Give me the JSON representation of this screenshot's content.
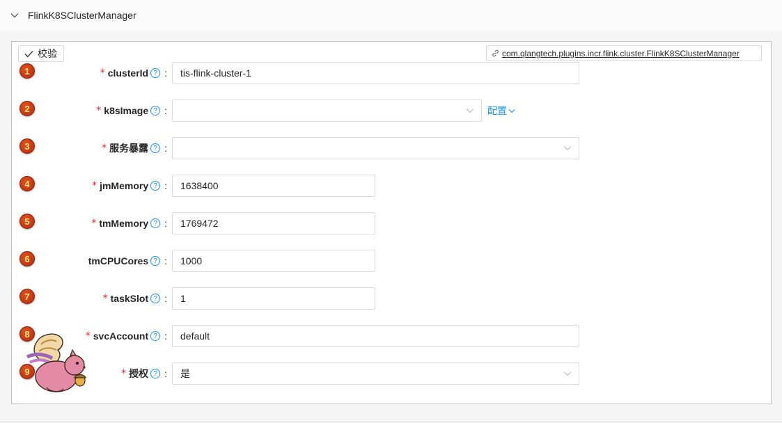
{
  "panel": {
    "title": "FlinkK8SClusterManager",
    "verify_label": "校验",
    "impl_link": "com.qlangtech.plugins.incr.flink.cluster.FlinkK8SClusterManager"
  },
  "fields": [
    {
      "badge": "1",
      "label": "clusterId",
      "required": true,
      "value": "tis-flink-cluster-1"
    },
    {
      "badge": "2",
      "label": "k8sImage",
      "required": true,
      "value": "",
      "config_label": "配置"
    },
    {
      "badge": "3",
      "label": "服务暴露",
      "required": true,
      "value": ""
    },
    {
      "badge": "4",
      "label": "jmMemory",
      "required": true,
      "value": "1638400"
    },
    {
      "badge": "5",
      "label": "tmMemory",
      "required": true,
      "value": "1769472"
    },
    {
      "badge": "6",
      "label": "tmCPUCores",
      "required": false,
      "value": "1000"
    },
    {
      "badge": "7",
      "label": "taskSlot",
      "required": true,
      "value": "1"
    },
    {
      "badge": "8",
      "label": "svcAccount",
      "required": true,
      "value": "default"
    },
    {
      "badge": "9",
      "label": "授权",
      "required": true,
      "value": "是"
    }
  ],
  "common": {
    "required_mark": "*",
    "help_mark": "?",
    "colon": ":"
  },
  "colors": {
    "accent": "#1890ff",
    "required": "#f5222d",
    "badge": "#c8381a"
  }
}
